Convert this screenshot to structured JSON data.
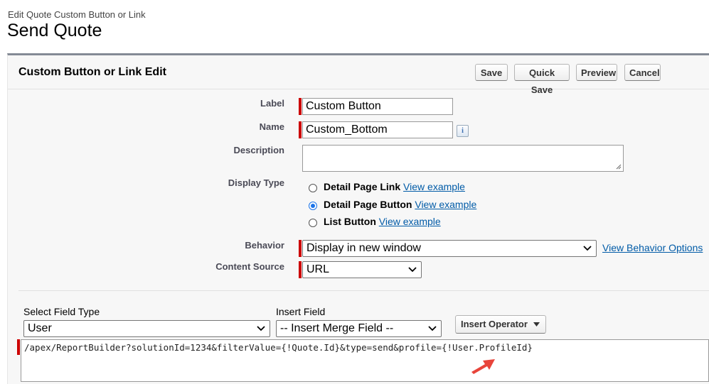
{
  "header": {
    "breadcrumb": "Edit Quote Custom Button or Link",
    "page_title": "Send Quote"
  },
  "panel": {
    "title": "Custom Button or Link Edit",
    "buttons": {
      "save": "Save",
      "quick_save": "Quick Save",
      "preview": "Preview",
      "cancel": "Cancel"
    }
  },
  "form": {
    "label": {
      "label": "Label",
      "value": "Custom Button"
    },
    "name": {
      "label": "Name",
      "value": "Custom_Bottom",
      "info_icon": "info-icon"
    },
    "description": {
      "label": "Description",
      "value": ""
    },
    "display_type": {
      "label": "Display Type",
      "selected": "Detail Page Button",
      "options": [
        {
          "label": "Detail Page Link",
          "link": "View example"
        },
        {
          "label": "Detail Page Button",
          "link": "View example"
        },
        {
          "label": "List Button",
          "link": "View example"
        }
      ]
    },
    "behavior": {
      "label": "Behavior",
      "value": "Display in new window",
      "link": "View Behavior Options"
    },
    "content_source": {
      "label": "Content Source",
      "value": "URL"
    }
  },
  "formula": {
    "field_type_label": "Select Field Type",
    "field_type_value": "User",
    "insert_field_label": "Insert Field",
    "insert_field_value": "-- Insert Merge Field --",
    "insert_operator": "Insert Operator",
    "code": "/apex/ReportBuilder?solutionId=1234&filterValue={!Quote.Id}&type=send&profile={!User.ProfileId}"
  },
  "colors": {
    "required_bar": "#cc0000",
    "link": "#015ba7",
    "annotation_arrow": "#e8443a",
    "radio_selected": "#1a73e8"
  }
}
